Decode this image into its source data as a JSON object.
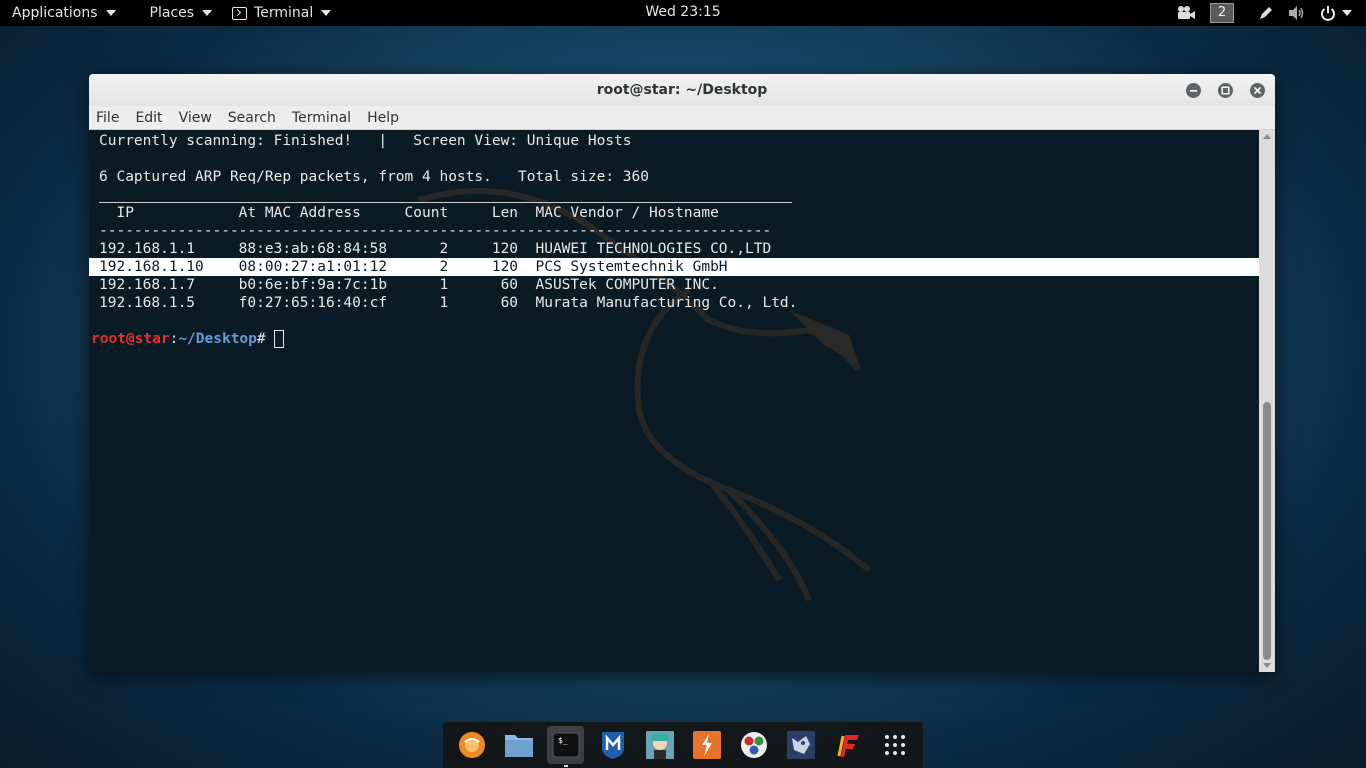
{
  "top_panel": {
    "applications_label": "Applications",
    "places_label": "Places",
    "terminal_label": "Terminal",
    "clock": "Wed 23:15",
    "workspace_number": "2"
  },
  "window": {
    "title": "root@star: ~/Desktop",
    "menu": [
      "File",
      "Edit",
      "View",
      "Search",
      "Terminal",
      "Help"
    ]
  },
  "terminal": {
    "status_line": "Currently scanning: Finished!   |   Screen View: Unique Hosts",
    "summary_line": "6 Captured ARP Req/Rep packets, from 4 hosts.   Total size: 360",
    "header_line": "  IP            At MAC Address     Count     Len  MAC Vendor / Hostname",
    "dash_line": "-----------------------------------------------------------------------------",
    "rows": [
      "192.168.1.1     88:e3:ab:68:84:58      2     120  HUAWEI TECHNOLOGIES CO.,LTD",
      "192.168.1.10    08:00:27:a1:01:12      2     120  PCS Systemtechnik GmbH",
      "192.168.1.7     b0:6e:bf:9a:7c:1b      1      60  ASUSTek COMPUTER INC.",
      "192.168.1.5     f0:27:65:16:40:cf      1      60  Murata Manufacturing Co., Ltd."
    ],
    "prompt_user": "root@star",
    "prompt_sep": ":",
    "prompt_path": "~/Desktop",
    "prompt_symbol": "# "
  },
  "dock": {
    "items": [
      "firefox-icon",
      "files-icon",
      "terminal-icon",
      "metasploit-icon",
      "armitage-icon",
      "burpsuite-icon",
      "maltego-icon",
      "beef-icon",
      "faraday-icon",
      "show-apps-icon"
    ]
  },
  "colors": {
    "prompt_user": "#e5302c",
    "prompt_path": "#6b9bd2",
    "selection_bg": "#ffffff"
  }
}
